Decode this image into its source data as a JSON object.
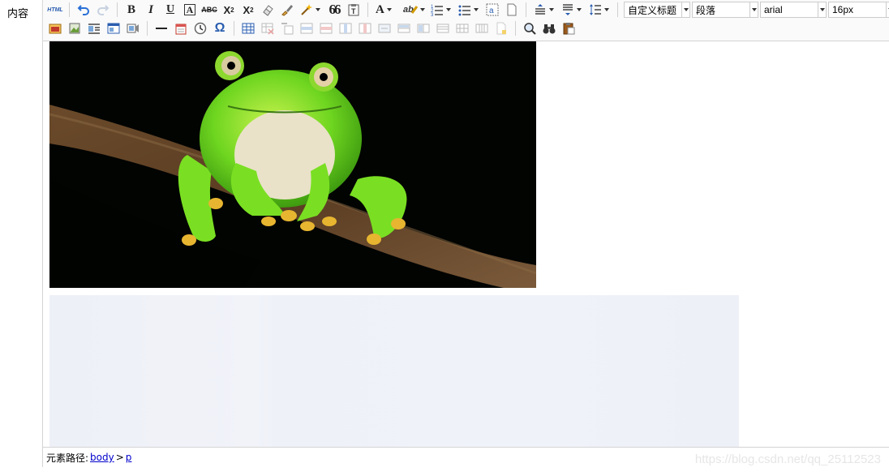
{
  "form": {
    "label": "内容"
  },
  "toolbar": {
    "html_label": "HTML",
    "bold": "B",
    "italic": "I",
    "underline": "U",
    "border_text": "A",
    "strike": "ABC",
    "superscript": "X",
    "superscript_mark": "2",
    "subscript": "X",
    "subscript_mark": "2",
    "blockquote": "66",
    "forecolor": "A",
    "omega": "Ω",
    "custom_heading": "自定义标题",
    "paragraph": "段落",
    "font_family": "arial",
    "font_size": "16px"
  },
  "statusbar": {
    "prefix": "元素路径:",
    "path_body": "body",
    "separator": ">",
    "path_p": "p"
  },
  "watermark": "https://blog.csdn.net/qq_25112523"
}
